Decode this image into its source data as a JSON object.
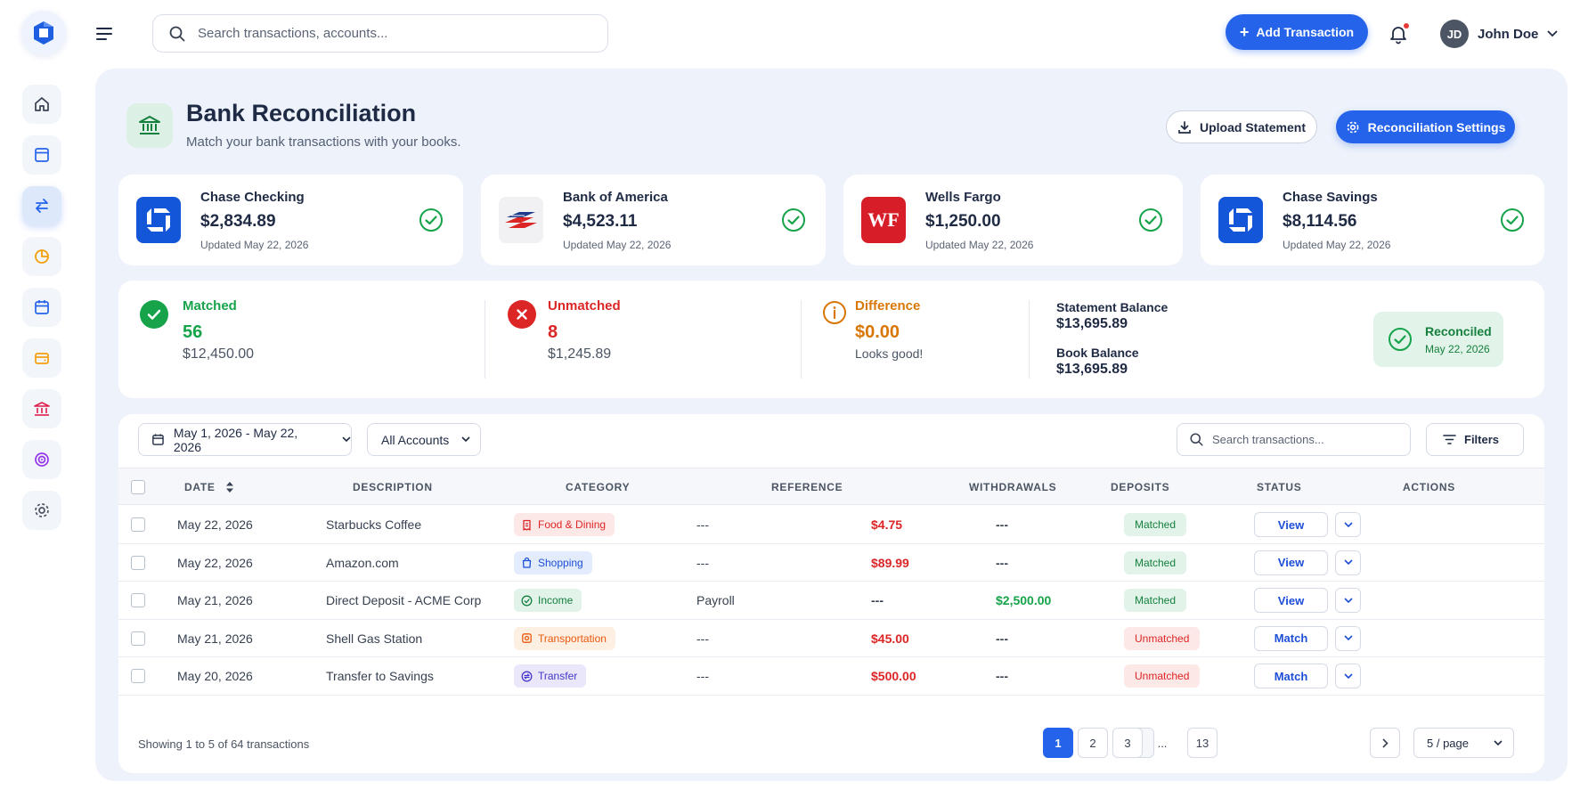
{
  "topbar": {
    "search_placeholder": "Search transactions, accounts...",
    "add_button": "Add Transaction",
    "user": {
      "initials": "JD",
      "name": "John Doe"
    }
  },
  "sidebar": {
    "items": [
      {
        "icon": "home-icon",
        "color": "#374151"
      },
      {
        "icon": "browser-icon",
        "color": "#2563eb"
      },
      {
        "icon": "transfer-icon",
        "color": "#2563eb",
        "active": true
      },
      {
        "icon": "pie-chart-icon",
        "color": "#f59e0b"
      },
      {
        "icon": "calendar-icon",
        "color": "#2563eb"
      },
      {
        "icon": "wallet-icon",
        "color": "#f59e0b"
      },
      {
        "icon": "bank-icon",
        "color": "#e11d48"
      },
      {
        "icon": "target-icon",
        "color": "#9333ea"
      },
      {
        "icon": "gear-icon",
        "color": "#4b5563"
      }
    ]
  },
  "header": {
    "title": "Bank Reconciliation",
    "subtitle": "Match your bank transactions with your books.",
    "upload_button": "Upload Statement",
    "settings_button": "Reconciliation Settings"
  },
  "accounts": [
    {
      "name": "Chase Checking",
      "balance": "$2,834.89",
      "updated": "Updated May 22, 2026",
      "logo": "chase-logo"
    },
    {
      "name": "Bank of America",
      "balance": "$4,523.11",
      "updated": "Updated May 22, 2026",
      "logo": "bofa-logo"
    },
    {
      "name": "Wells Fargo",
      "balance": "$1,250.00",
      "updated": "Updated May 22, 2026",
      "logo": "wells-fargo-logo",
      "logo_text": "WF"
    },
    {
      "name": "Chase Savings",
      "balance": "$8,114.56",
      "updated": "Updated May 22, 2026",
      "logo": "chase-logo"
    }
  ],
  "summary": {
    "matched": {
      "label": "Matched",
      "count": "56",
      "amount": "$12,450.00",
      "color": "#16a34a"
    },
    "unmatched": {
      "label": "Unmatched",
      "count": "8",
      "amount": "$1,245.89",
      "color": "#dc2626"
    },
    "difference": {
      "label": "Difference",
      "value": "$0.00",
      "note": "Looks good!",
      "color": "#d97706"
    },
    "statement_balance": {
      "label": "Statement Balance",
      "value": "$13,695.89"
    },
    "book_balance": {
      "label": "Book Balance",
      "value": "$13,695.89"
    },
    "reconciled": {
      "label": "Reconciled",
      "date": "May 22, 2026"
    }
  },
  "filters": {
    "date_range": "May 1, 2026 - May 22, 2026",
    "accounts": "All Accounts",
    "search_placeholder": "Search transactions...",
    "filters_button": "Filters"
  },
  "table": {
    "headers": {
      "date": "DATE",
      "description": "DESCRIPTION",
      "category": "CATEGORY",
      "reference": "REFERENCE",
      "withdrawals": "WITHDRAWALS",
      "deposits": "DEPOSITS",
      "status": "STATUS",
      "actions": "ACTIONS"
    },
    "rows": [
      {
        "date": "May 22, 2026",
        "description": "Starbucks Coffee",
        "category": "Food & Dining",
        "reference": "---",
        "withdrawal": "$4.75",
        "deposit": "---",
        "status": "Matched",
        "action": "View"
      },
      {
        "date": "May 22, 2026",
        "description": "Amazon.com",
        "category": "Shopping",
        "reference": "---",
        "withdrawal": "$89.99",
        "deposit": "---",
        "status": "Matched",
        "action": "View"
      },
      {
        "date": "May 21, 2026",
        "description": "Direct Deposit - ACME Corp",
        "category": "Income",
        "reference": "Payroll",
        "withdrawal": "---",
        "deposit": "$2,500.00",
        "status": "Matched",
        "action": "View"
      },
      {
        "date": "May 21, 2026",
        "description": "Shell Gas Station",
        "category": "Transportation",
        "reference": "---",
        "withdrawal": "$45.00",
        "deposit": "---",
        "status": "Unmatched",
        "action": "Match"
      },
      {
        "date": "May 20, 2026",
        "description": "Transfer to Savings",
        "category": "Transfer",
        "reference": "---",
        "withdrawal": "$500.00",
        "deposit": "---",
        "status": "Unmatched",
        "action": "Match"
      }
    ]
  },
  "categories": {
    "Food & Dining": {
      "bg": "#fde8e8",
      "fg": "#dc2626",
      "icon": "receipt-icon"
    },
    "Shopping": {
      "bg": "#e3ecfd",
      "fg": "#1d4ed8",
      "icon": "bag-icon"
    },
    "Income": {
      "bg": "#e2f3ea",
      "fg": "#15803d",
      "icon": "dollar-circle-icon"
    },
    "Transportation": {
      "bg": "#fdefe2",
      "fg": "#ea580c",
      "icon": "car-icon"
    },
    "Transfer": {
      "bg": "#ebe7fb",
      "fg": "#4338ca",
      "icon": "transfer-icon"
    }
  },
  "pagination": {
    "showing": "Showing 1 to 5 of 64 transactions",
    "pages": [
      "1",
      "2",
      "3",
      "...",
      "13"
    ],
    "current": "1",
    "per_page": "5 / page"
  },
  "colors": {
    "accent": "#2563eb",
    "withdrawal": "#dc2626",
    "deposit": "#16a34a"
  }
}
